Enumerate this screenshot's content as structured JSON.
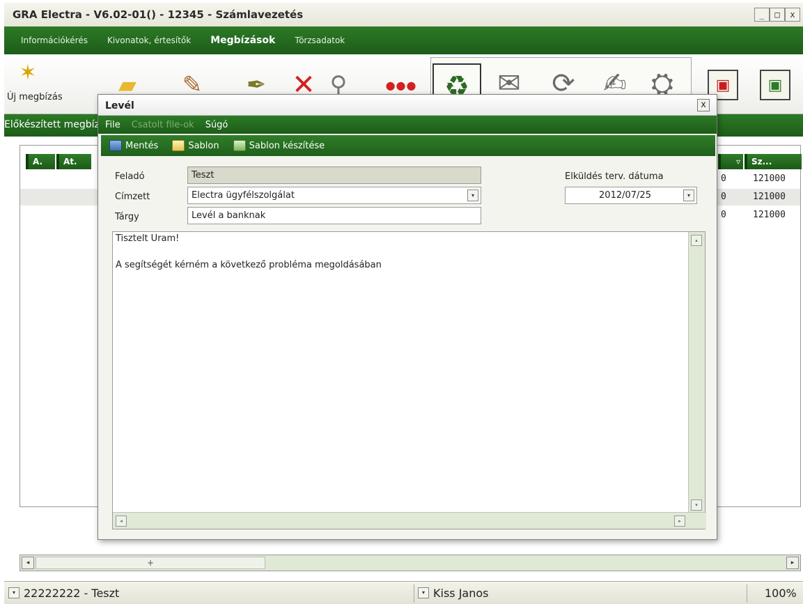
{
  "app": {
    "title": "GRA Electra - V6.02-01() - 12345 - Számlavezetés",
    "win_min": "_",
    "win_max": "□",
    "win_close": "x"
  },
  "menu": {
    "items": [
      {
        "label": "Információkérés",
        "active": false
      },
      {
        "label": "Kivonatok, értesítők",
        "active": false
      },
      {
        "label": "Megbízások",
        "active": true
      },
      {
        "label": "Törzsadatok",
        "active": false
      }
    ]
  },
  "toolbar": {
    "new_order_label": "Új megbízás"
  },
  "strip": {
    "text": "Előkészített megbízások"
  },
  "grid": {
    "headers": [
      "A.",
      "At."
    ],
    "right_headers": [
      "",
      "Sz..."
    ],
    "rows": [
      {
        "c1": "0",
        "c2": "121000"
      },
      {
        "c1": "0",
        "c2": "121000"
      },
      {
        "c1": "0",
        "c2": "121000"
      }
    ],
    "hscroll_thumb": "+"
  },
  "status": {
    "account": "22222222 - Teszt",
    "user": "Kiss Janos",
    "zoom": "100%"
  },
  "dialog": {
    "title": "Levél",
    "close": "x",
    "menu": [
      {
        "label": "File",
        "disabled": false
      },
      {
        "label": "Csatolt file-ok",
        "disabled": true
      },
      {
        "label": "Súgó",
        "disabled": false
      }
    ],
    "toolbar": {
      "save": "Mentés",
      "template": "Sablon",
      "make_template": "Sablon készítése"
    },
    "form": {
      "sender_label": "Feladó",
      "sender_value": "Teszt",
      "recipient_label": "Címzett",
      "recipient_value": "Electra ügyfélszolgálat",
      "subject_label": "Tárgy",
      "subject_value": "Levél a banknak",
      "date_label": "Elküldés terv. dátuma",
      "date_value": "2012/07/25"
    },
    "body": {
      "line1": "Tisztelt Uram!",
      "line2": "A segítségét kérném a következő probléma megoldásában"
    }
  }
}
